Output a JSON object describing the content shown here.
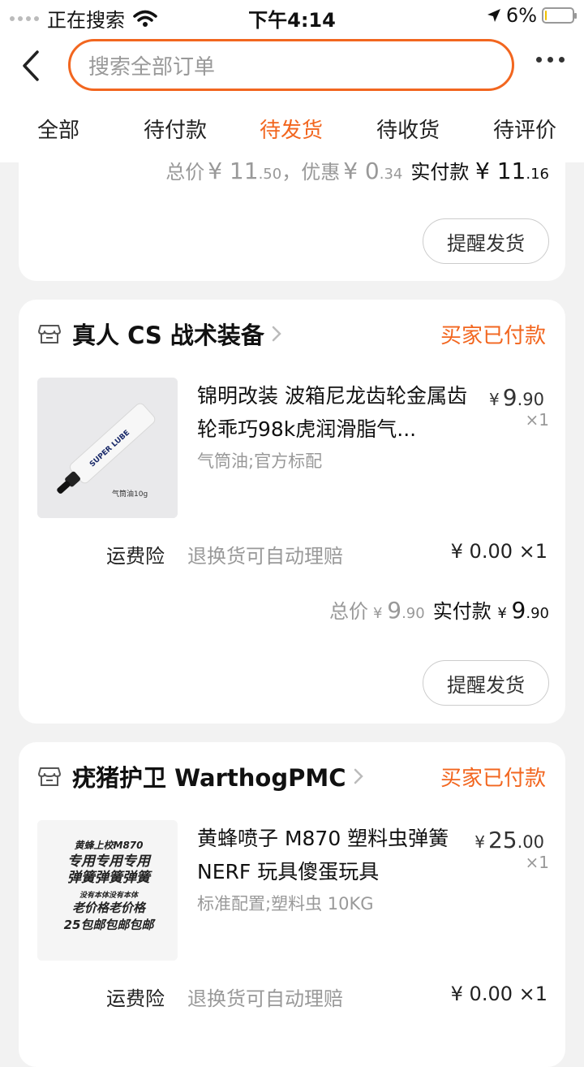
{
  "status_bar": {
    "carrier": "正在搜索",
    "time": "下午4:14",
    "battery": "6%",
    "battery_level": 0.06
  },
  "header": {
    "search_placeholder": "搜索全部订单"
  },
  "tabs": [
    {
      "label": "全部"
    },
    {
      "label": "待付款"
    },
    {
      "label": "待发货",
      "active": true
    },
    {
      "label": "待收货"
    },
    {
      "label": "待评价"
    }
  ],
  "prev_order": {
    "total_label": "总价",
    "total_int": "¥ 11",
    "total_dec": ".50",
    "discount_label": "，优惠",
    "discount_int": "¥ 0",
    "discount_dec": ".34",
    "paid_label": "实付款",
    "paid_int": "¥ 11",
    "paid_dec": ".16",
    "button": "提醒发货"
  },
  "orders": [
    {
      "shop": "真人 CS 战术装备",
      "status": "买家已付款",
      "product": {
        "title": "锦明改装 波箱尼龙齿轮金属齿轮乖巧98k虎润滑脂气...",
        "spec": "气筒油;官方标配",
        "price_int": "9",
        "price_dec": ".90",
        "qty": "×1",
        "image_text": [
          "SUPER LUBE",
          "气筒油10g"
        ]
      },
      "insurance": {
        "label": "运费险",
        "desc": "退换货可自动理赔",
        "price": "¥ 0.00 ×1"
      },
      "totals": {
        "total_label": "总价",
        "total_int": "9",
        "total_dec": ".90",
        "paid_label": "实付款",
        "paid_int": "9",
        "paid_dec": ".90"
      },
      "button": "提醒发货"
    },
    {
      "shop": "疣猪护卫 WarthogPMC",
      "status": "买家已付款",
      "product": {
        "title": "黄蜂喷子 M870 塑料虫弹簧 NERF 玩具傻蛋玩具",
        "spec": "标准配置;塑料虫 10KG",
        "price_int": "25",
        "price_dec": ".00",
        "qty": "×1",
        "image_text": [
          "黄蜂上校M870",
          "专用专用专用",
          "弹簧弹簧弹簧",
          "没有本体没有本体",
          "老价格老价格",
          "25包邮包邮包邮"
        ]
      },
      "insurance": {
        "label": "运费险",
        "desc": "退换货可自动理赔",
        "price": "¥ 0.00 ×1"
      }
    }
  ],
  "colors": {
    "accent": "#f2661f",
    "muted": "#999999",
    "background": "#f2f2f2"
  }
}
